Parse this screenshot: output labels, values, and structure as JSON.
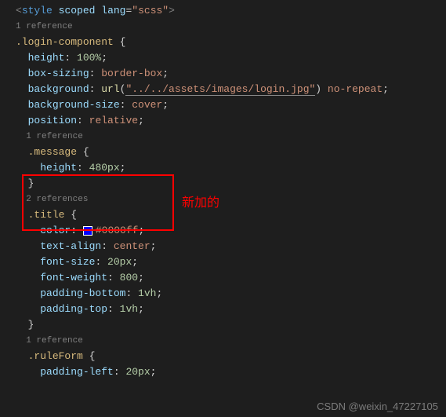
{
  "styleTag": {
    "open": "<",
    "name": "style",
    "attr1n": "scoped",
    "attr2n": "lang",
    "attr2v": "\"scss\"",
    "close": ">"
  },
  "refs": {
    "one": "1 reference",
    "two": "2 references"
  },
  "sel": {
    "loginComponent": ".login-component",
    "message": ".message",
    "title": ".title",
    "ruleForm": ".ruleForm"
  },
  "props": {
    "height": "height",
    "boxSizing": "box-sizing",
    "background": "background",
    "backgroundSize": "background-size",
    "position": "position",
    "color": "color",
    "textAlign": "text-align",
    "fontSize": "font-size",
    "fontWeight": "font-weight",
    "paddingBottom": "padding-bottom",
    "paddingTop": "padding-top",
    "paddingLeft": "padding-left"
  },
  "vals": {
    "pct100": "100%",
    "borderBox": "border-box",
    "urlFn": "url",
    "urlArg": "\"../../assets/images/login.jpg\"",
    "noRepeat": " no-repeat",
    "cover": "cover",
    "relative": "relative",
    "px480": "480px",
    "color0000ff": "#0000ff",
    "center": "center",
    "px20": "20px",
    "w800": "800",
    "vh1": "1vh"
  },
  "punct": {
    "lbrace": " {",
    "rbrace": "}",
    "colon": ": ",
    "semi": ";"
  },
  "annotation": "新加的",
  "watermark": "CSDN @weixin_47227105"
}
